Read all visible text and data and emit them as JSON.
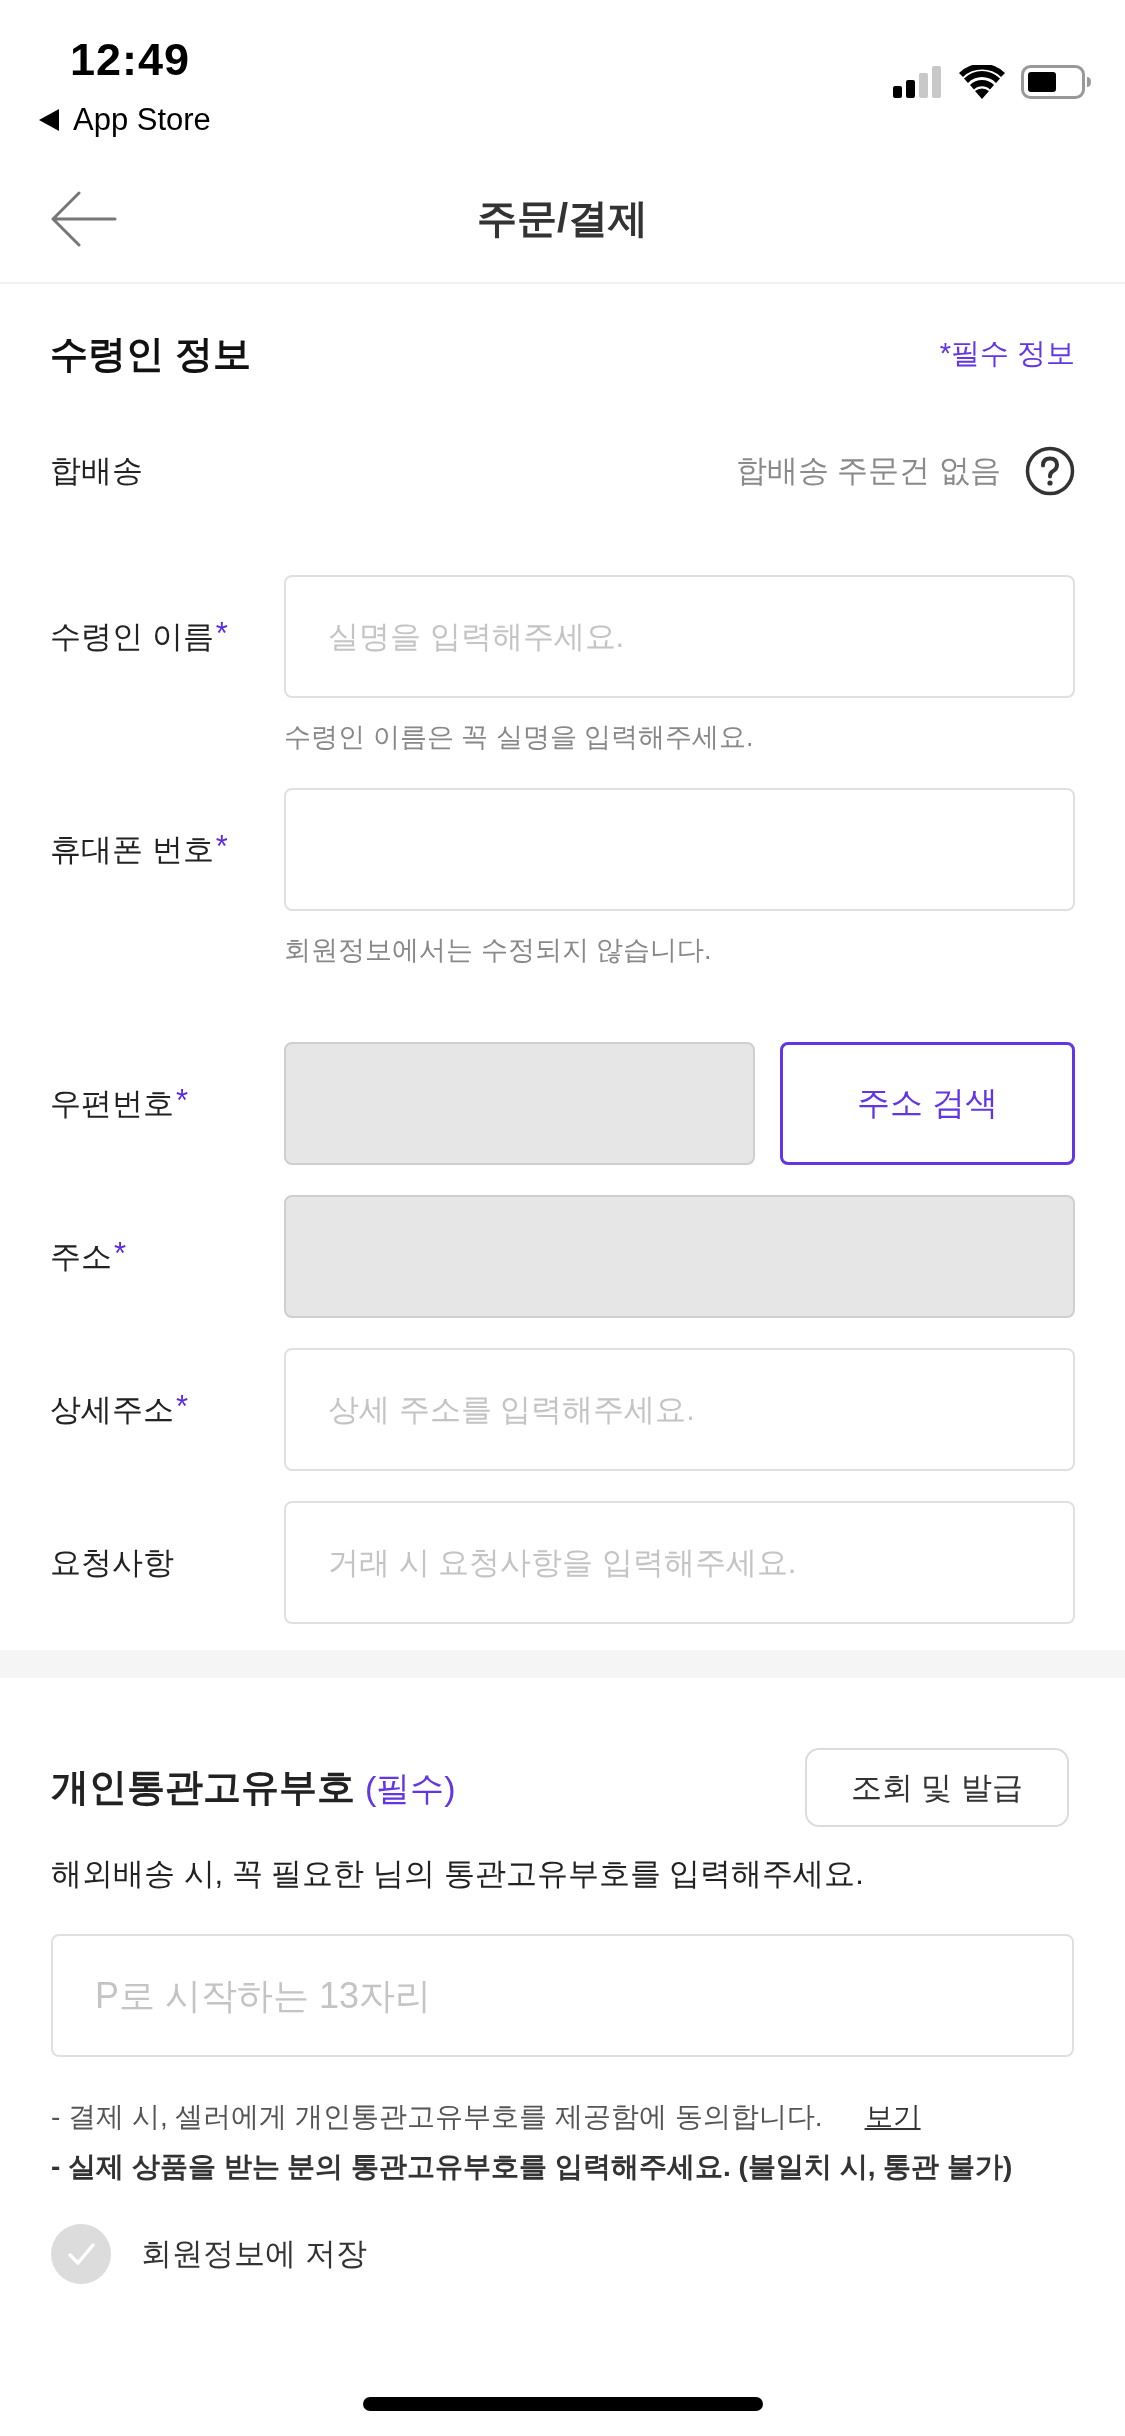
{
  "status_bar": {
    "time": "12:49",
    "back_label": "App Store"
  },
  "header": {
    "title": "주문/결제"
  },
  "recipient": {
    "title": "수령인 정보",
    "required_note": "*필수 정보",
    "combined_shipping": {
      "label": "합배송",
      "value": "합배송 주문건 없음"
    },
    "fields": [
      {
        "kind": "text",
        "label": "수령인 이름",
        "required_mark": "*",
        "disabled": false,
        "placeholder": "실명을 입력해주세요.",
        "helper": "수령인 이름은 꼭 실명을 입력해주세요."
      },
      {
        "kind": "text",
        "label": "휴대폰 번호",
        "required_mark": "*",
        "disabled": false,
        "helper": "회원정보에서는 수정되지 않습니다."
      },
      {
        "kind": "search",
        "label": "우편번호",
        "required_mark": "*",
        "disabled": true,
        "button": "주소 검색"
      },
      {
        "kind": "text",
        "label": "주소",
        "required_mark": "*",
        "disabled": true
      },
      {
        "kind": "text",
        "label": "상세주소",
        "required_mark": "*",
        "disabled": false,
        "placeholder": "상세 주소를 입력해주세요."
      },
      {
        "kind": "text",
        "label": "요청사항",
        "disabled": false,
        "placeholder": "거래 시 요청사항을 입력해주세요."
      }
    ]
  },
  "customs": {
    "title": "개인통관고유부호",
    "required_tag": "(필수)",
    "lookup_button": "조회 및 발급",
    "description": "해외배송 시, 꼭 필요한 님의 통관고유부호를 입력해주세요.",
    "input": {
      "placeholder": "P로 시작하는 13자리"
    },
    "notes": [
      {
        "text": "- 결제 시, 셀러에게 개인통관고유부호를 제공함에 동의합니다.",
        "link": "보기",
        "bold": false
      },
      {
        "text": "- 실제 상품을 받는 분의 통관고유부호를 입력해주세요. (불일치 시, 통관 불가)",
        "bold": true
      }
    ],
    "save_option": {
      "label": "회원정보에 저장",
      "checked": false
    }
  }
}
